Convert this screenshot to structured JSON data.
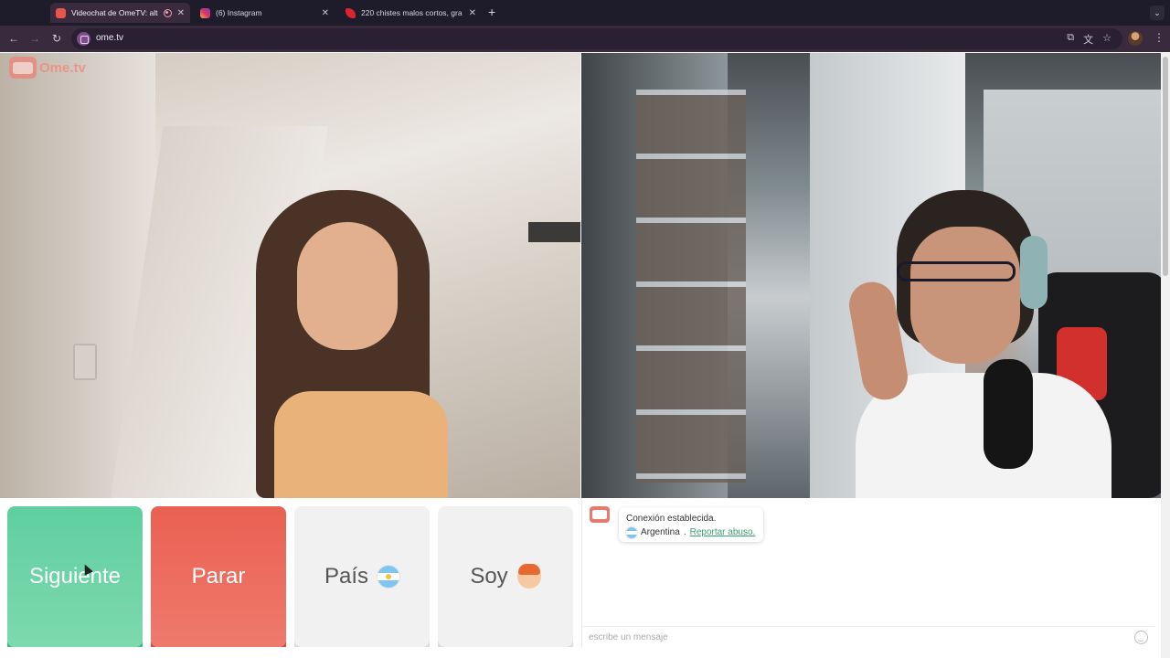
{
  "browser": {
    "tabs": [
      {
        "title": "Videochat de OmeTV: alte",
        "active": true,
        "favicon_color": "#e8564a"
      },
      {
        "title": "(6) Instagram",
        "active": false,
        "favicon_color": "#d6336c"
      },
      {
        "title": "220 chistes malos cortos, gra",
        "active": false,
        "favicon_color": "#d9262e"
      }
    ],
    "url": "ome.tv"
  },
  "logo": {
    "text": "Ome.tv"
  },
  "controls": {
    "next_label": "Siguiente",
    "stop_label": "Parar",
    "country_label": "País",
    "gender_label": "Soy",
    "country_flag": "argentina-flag-icon",
    "gender_icon": "boy-emoji-icon"
  },
  "chat": {
    "status": "Conexión establecida.",
    "country": "Argentina",
    "separator": ".",
    "report_link": "Reportar abuso.",
    "input_placeholder": "escribe un mensaje"
  },
  "colors": {
    "next": "#5fcf9f",
    "stop": "#e96052",
    "neutral_button": "#f1f1f1",
    "brand": "#e77a6e",
    "browser_bg": "#3a2a3e"
  }
}
